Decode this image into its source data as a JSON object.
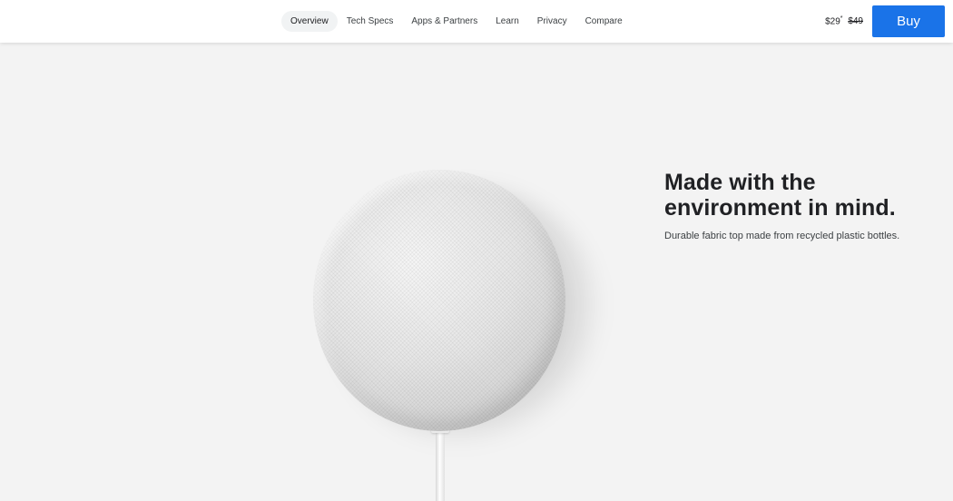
{
  "nav": {
    "items": [
      {
        "label": "Overview",
        "active": true
      },
      {
        "label": "Tech Specs",
        "active": false
      },
      {
        "label": "Apps & Partners",
        "active": false
      },
      {
        "label": "Learn",
        "active": false
      },
      {
        "label": "Privacy",
        "active": false
      },
      {
        "label": "Compare",
        "active": false
      }
    ]
  },
  "price": {
    "current": "$29",
    "footnote_mark": "*",
    "original": "$49"
  },
  "buy": {
    "label": "Buy"
  },
  "hero": {
    "headline_line1": "Made with the",
    "headline_line2": "environment in mind.",
    "subtext": "Durable fabric top made from recycled plastic bottles."
  },
  "colors": {
    "accent": "#1a73e8",
    "background": "#f3f3f3",
    "header": "#ffffff"
  }
}
